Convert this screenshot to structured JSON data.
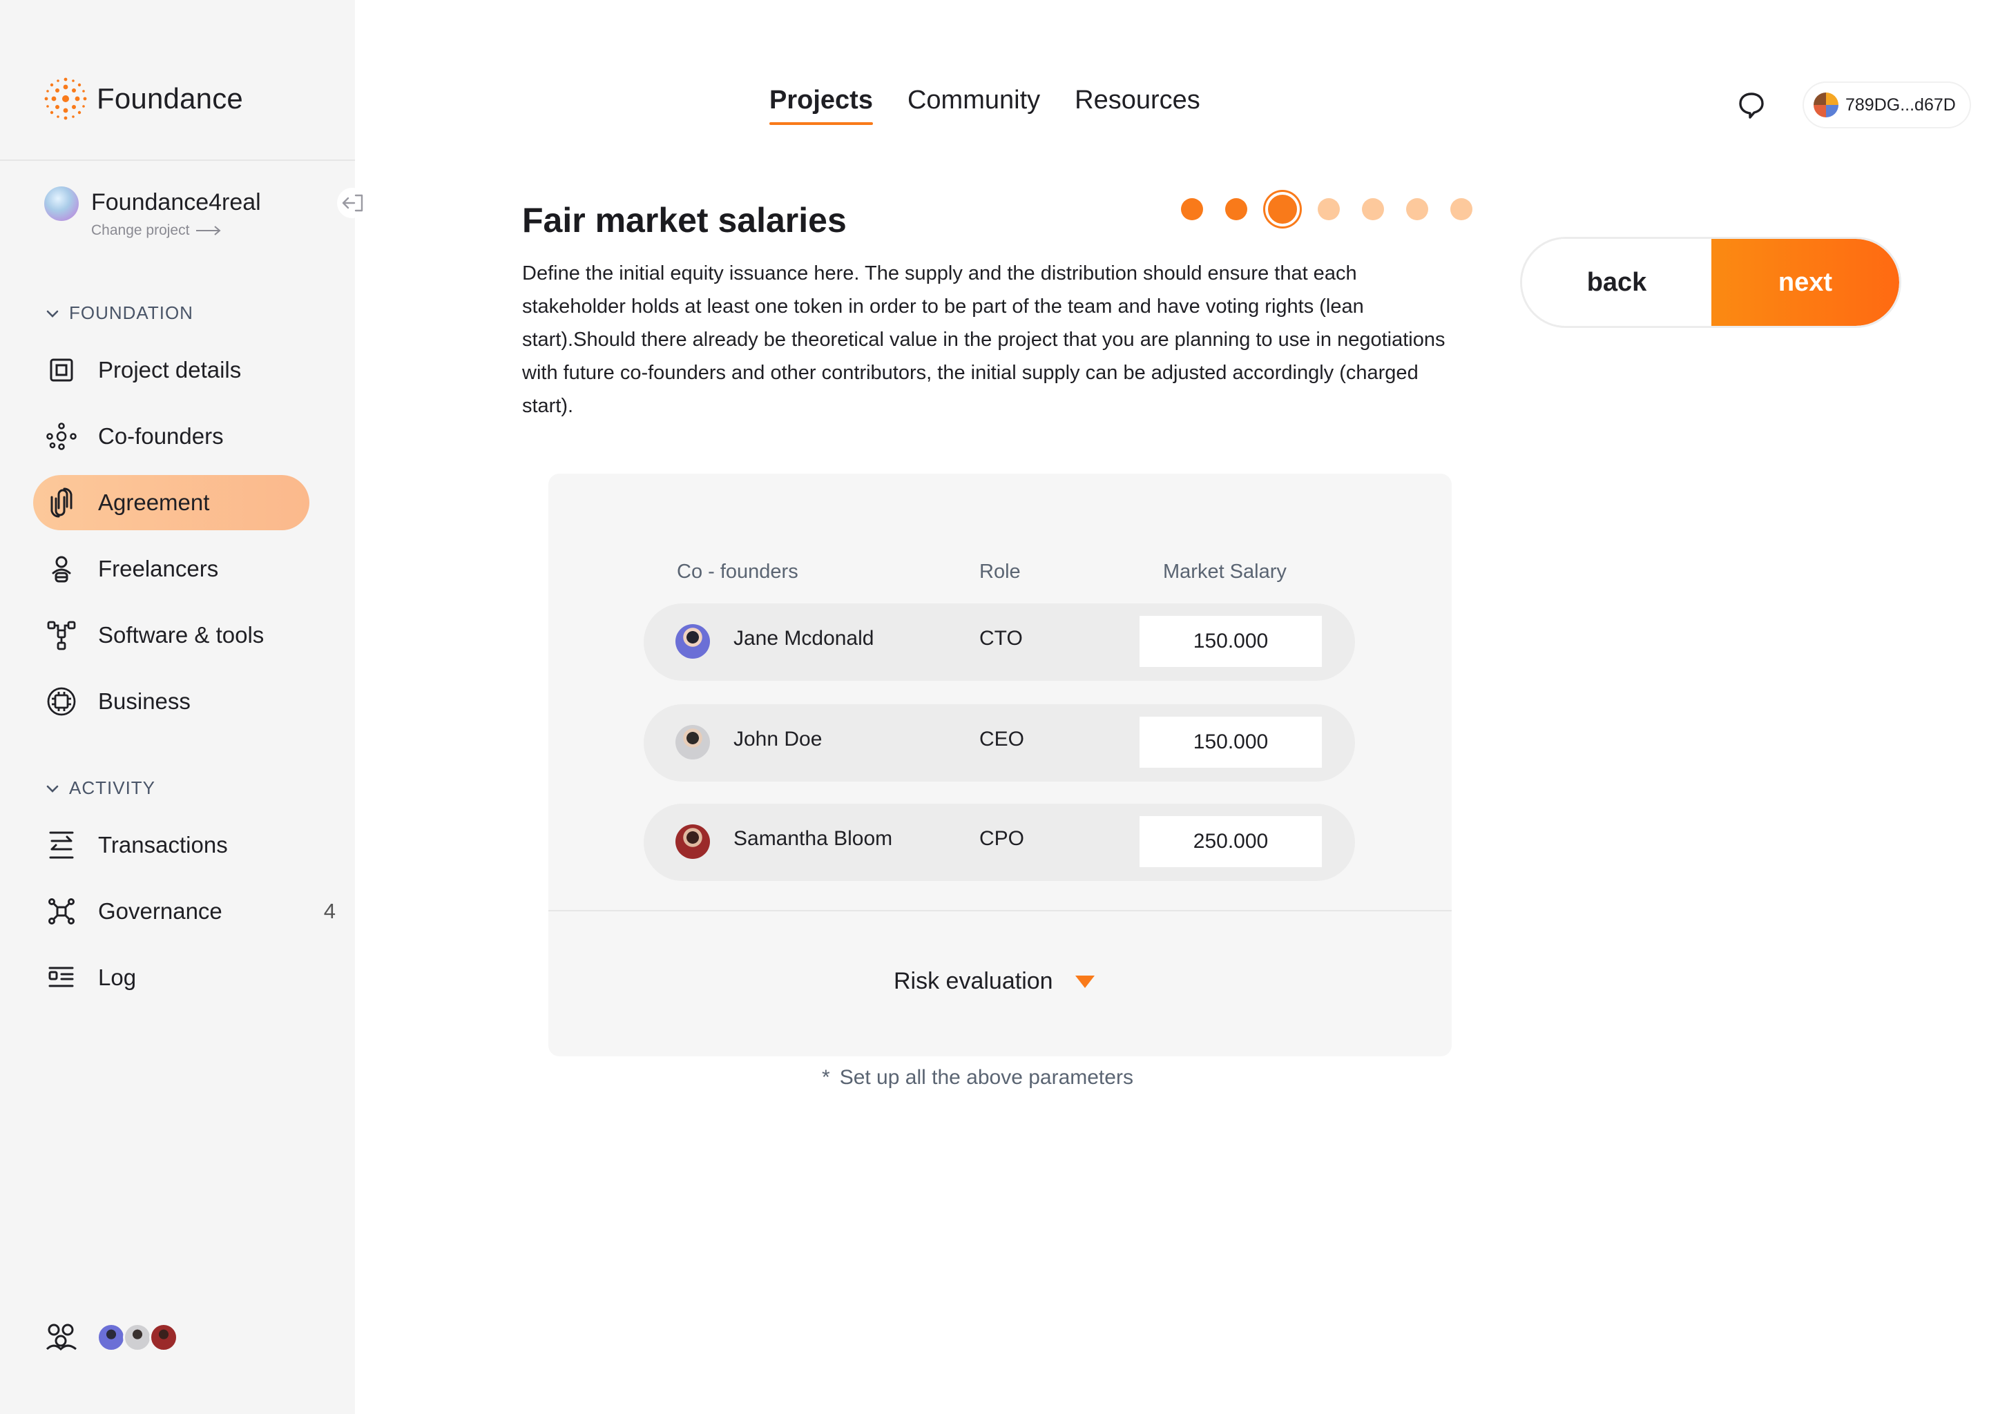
{
  "app": {
    "name": "Foundance"
  },
  "project": {
    "name": "Foundance4real",
    "change_label": "Change project"
  },
  "sidebar": {
    "foundation_title": "FOUNDATION",
    "foundation_items": [
      {
        "label": "Project details",
        "icon": "square-frame-icon"
      },
      {
        "label": "Co-founders",
        "icon": "cofounders-icon"
      },
      {
        "label": "Agreement",
        "icon": "link-icon",
        "active": true
      },
      {
        "label": "Freelancers",
        "icon": "person-icon"
      },
      {
        "label": "Software & tools",
        "icon": "hierarchy-icon"
      },
      {
        "label": "Business",
        "icon": "chip-icon"
      }
    ],
    "activity_title": "ACTIVITY",
    "activity_items": [
      {
        "label": "Transactions",
        "icon": "transfer-icon"
      },
      {
        "label": "Governance",
        "icon": "network-icon",
        "count": "4"
      },
      {
        "label": "Log",
        "icon": "list-icon"
      }
    ]
  },
  "topnav": {
    "items": [
      "Projects",
      "Community",
      "Resources"
    ],
    "active": "Projects"
  },
  "wallet": {
    "address": "789DG...d67D"
  },
  "page": {
    "title": "Fair market salaries",
    "description": "Define the initial equity issuance here. The supply and the distribution should ensure that each stakeholder holds at least one token in order to be part of the team and have voting rights (lean start).Should there already be theoretical value in the project that you are planning to use in negotiations with future co-founders and other contributors, the initial supply can be adjusted accordingly (charged start).",
    "steps_total": 7,
    "step_current": 3
  },
  "buttons": {
    "back": "back",
    "next": "next"
  },
  "table": {
    "headers": {
      "cofounders": "Co - founders",
      "role": "Role",
      "salary": "Market Salary"
    },
    "rows": [
      {
        "name": "Jane Mcdonald",
        "role": "CTO",
        "salary": "150.000"
      },
      {
        "name": "John Doe",
        "role": "CEO",
        "salary": "150.000"
      },
      {
        "name": "Samantha Bloom",
        "role": "CPO",
        "salary": "250.000"
      }
    ]
  },
  "risk": {
    "label": "Risk evaluation"
  },
  "hint": {
    "star": "*",
    "text": "Set up all the above parameters"
  },
  "colors": {
    "accent": "#f97a1a",
    "accent_light": "#fdc99c",
    "sidebar_bg": "#f5f5f5",
    "panel_bg": "#f6f6f6"
  }
}
